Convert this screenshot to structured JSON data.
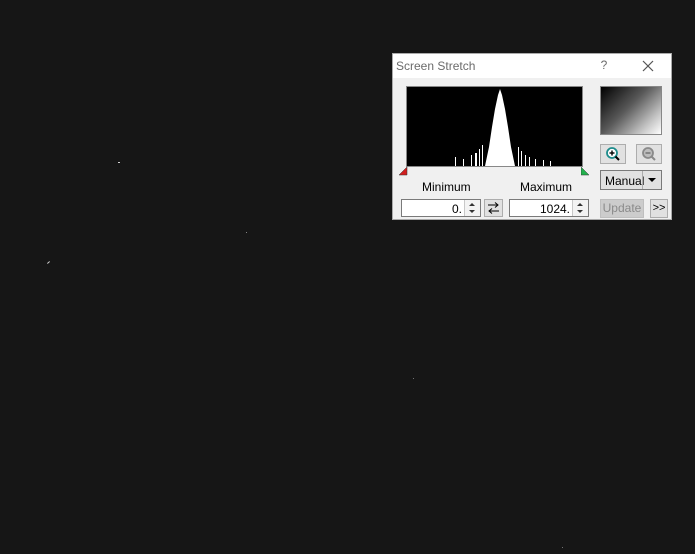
{
  "window": {
    "title": "Screen Stretch",
    "help_label": "?",
    "close_icon": "close-icon"
  },
  "histogram": {
    "min_marker_color": "#d21f1f",
    "max_marker_color": "#22b14c"
  },
  "labels": {
    "minimum": "Minimum",
    "maximum": "Maximum"
  },
  "fields": {
    "minimum_value": "0.",
    "maximum_value": "1024."
  },
  "controls": {
    "swap_icon": "swap-arrows-icon",
    "zoom_in_icon": "zoom-in-icon",
    "zoom_out_icon": "zoom-out-icon",
    "mode_value": "Manual",
    "update_label": "Update",
    "more_label": ">>"
  },
  "colors": {
    "background": "#161616",
    "dialog_bg": "#f0f0f0",
    "zoom_icon_accent": "#1e8c8c"
  }
}
